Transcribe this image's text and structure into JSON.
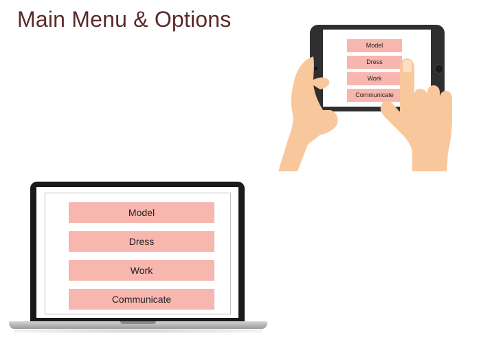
{
  "page": {
    "title": "Main Menu & Options"
  },
  "tablet": {
    "menu": [
      {
        "label": "Model"
      },
      {
        "label": "Dress"
      },
      {
        "label": "Work"
      },
      {
        "label": "Communicate"
      }
    ]
  },
  "laptop": {
    "menu": [
      {
        "label": "Model"
      },
      {
        "label": "Dress"
      },
      {
        "label": "Work"
      },
      {
        "label": "Communicate"
      }
    ]
  },
  "colors": {
    "title": "#5a2a2a",
    "menu_button": "#f7b6ae",
    "device_frame": "#1a1a1a",
    "skin": "#f9c79c"
  }
}
